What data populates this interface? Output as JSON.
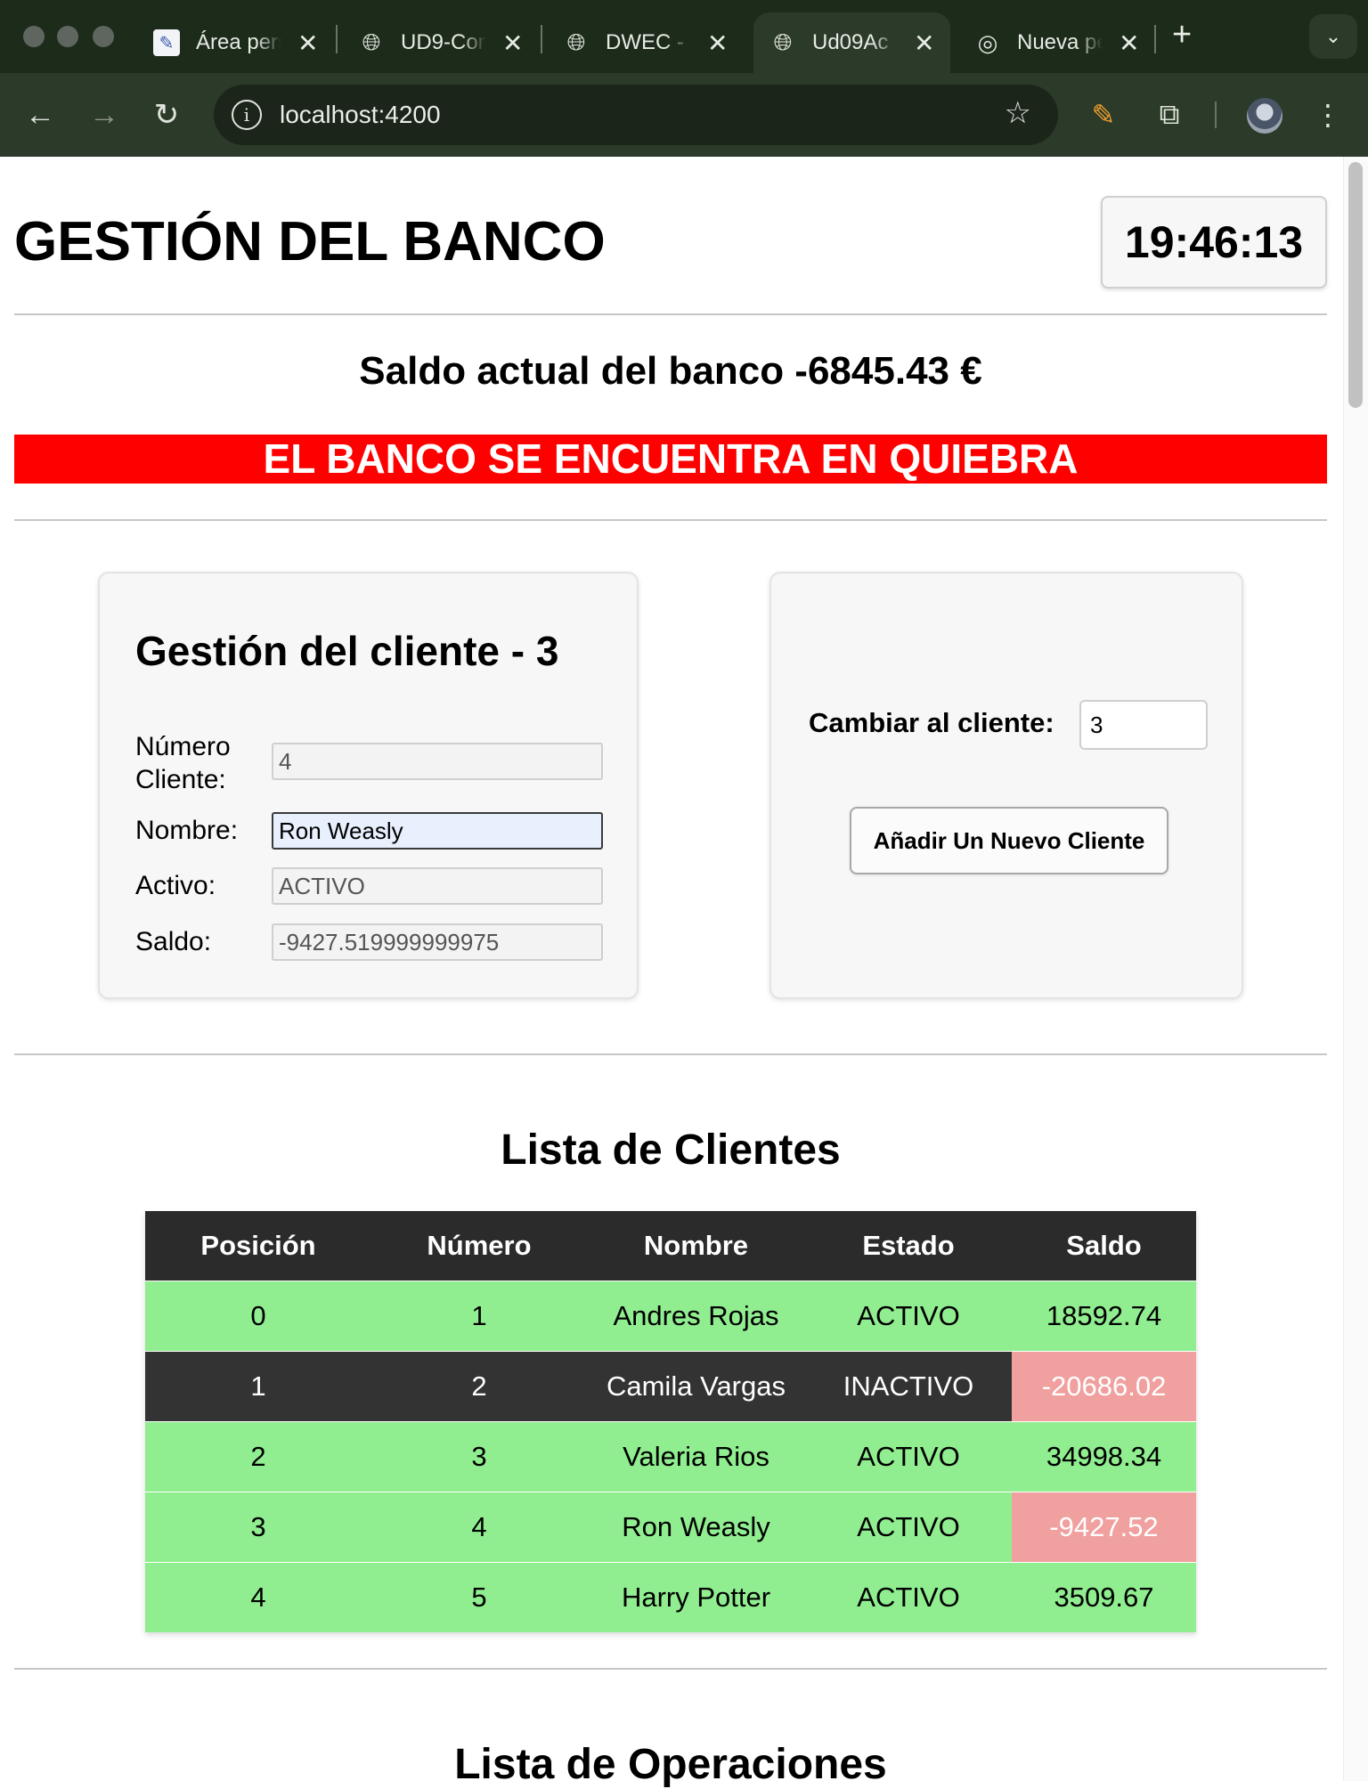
{
  "browser": {
    "tabs": [
      {
        "label": "Área personal",
        "icon": "document-icon",
        "active": false
      },
      {
        "label": "UD9-Con",
        "icon": "globe-icon",
        "active": false
      },
      {
        "label": "DWEC - ",
        "icon": "globe-icon",
        "active": false
      },
      {
        "label": "Ud09Ac",
        "icon": "globe-icon",
        "active": true
      },
      {
        "label": "Nueva pestaña",
        "icon": "chrome-icon",
        "active": false
      }
    ],
    "url": "localhost:4200"
  },
  "header": {
    "title": "GESTIÓN DEL BANCO",
    "clock": "19:46:13"
  },
  "bank": {
    "balance_text": "Saldo actual del banco -6845.43 €",
    "alert": "EL BANCO SE ENCUENTRA EN QUIEBRA",
    "alert_color": "#ff0000"
  },
  "client_panel": {
    "title": "Gestión del cliente - 3",
    "fields": {
      "numero": {
        "label": "Número Cliente:",
        "value": "4"
      },
      "nombre": {
        "label": "Nombre:",
        "value": "Ron Weasly"
      },
      "activo": {
        "label": "Activo:",
        "value": "ACTIVO"
      },
      "saldo": {
        "label": "Saldo:",
        "value": "-9427.519999999975"
      }
    }
  },
  "switch_panel": {
    "label": "Cambiar al cliente:",
    "value": "3",
    "add_button": "Añadir Un Nuevo Cliente"
  },
  "clients_list": {
    "title": "Lista de Clientes",
    "headers": [
      "Posición",
      "Número",
      "Nombre",
      "Estado",
      "Saldo"
    ],
    "rows": [
      {
        "pos": "0",
        "num": "1",
        "name": "Andres Rojas",
        "estado": "ACTIVO",
        "saldo": "18592.74",
        "negative": false
      },
      {
        "pos": "1",
        "num": "2",
        "name": "Camila Vargas",
        "estado": "INACTIVO",
        "saldo": "-20686.02",
        "negative": true
      },
      {
        "pos": "2",
        "num": "3",
        "name": "Valeria Rios",
        "estado": "ACTIVO",
        "saldo": "34998.34",
        "negative": false
      },
      {
        "pos": "3",
        "num": "4",
        "name": "Ron Weasly",
        "estado": "ACTIVO",
        "saldo": "-9427.52",
        "negative": true
      },
      {
        "pos": "4",
        "num": "5",
        "name": "Harry Potter",
        "estado": "ACTIVO",
        "saldo": "3509.67",
        "negative": false
      }
    ],
    "colors": {
      "activo": "#90ee90",
      "inactivo": "#333333",
      "negative": "#f0a09f"
    }
  },
  "operations_list": {
    "title": "Lista de Operaciones"
  }
}
